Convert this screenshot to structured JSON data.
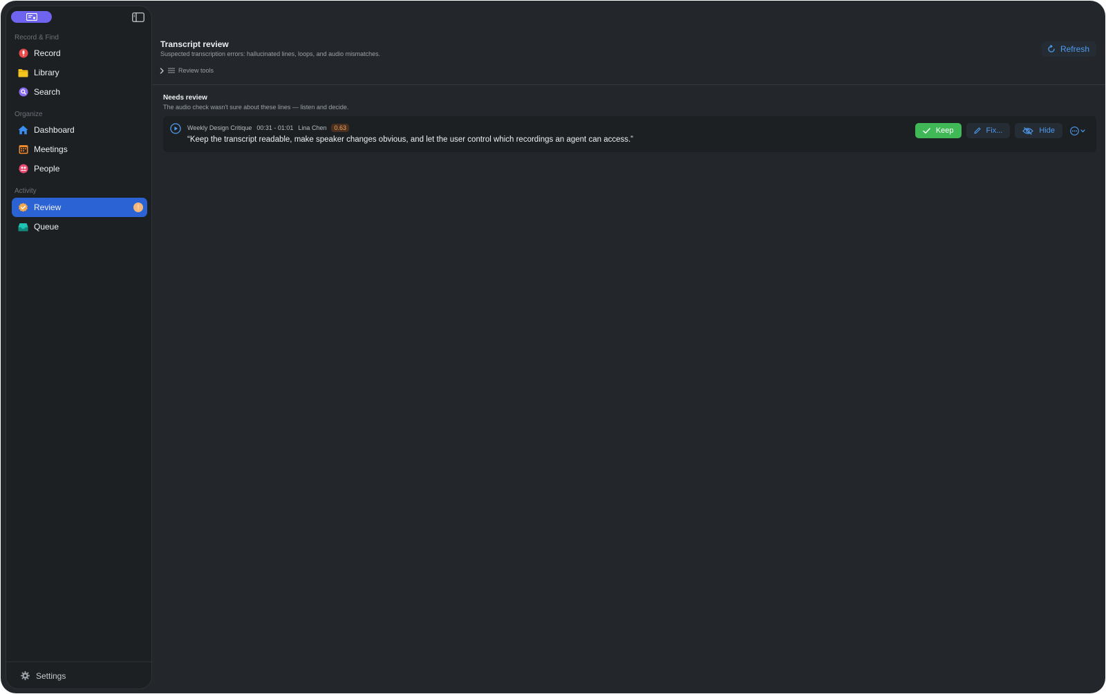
{
  "sidebar": {
    "sections": [
      {
        "label": "Record & Find"
      },
      {
        "label": "Organize"
      },
      {
        "label": "Activity"
      }
    ],
    "items": [
      {
        "label": "Record",
        "icon": "record-icon"
      },
      {
        "label": "Library",
        "icon": "folder-icon"
      },
      {
        "label": "Search",
        "icon": "search-icon"
      },
      {
        "label": "Dashboard",
        "icon": "home-icon"
      },
      {
        "label": "Meetings",
        "icon": "calendar-icon"
      },
      {
        "label": "People",
        "icon": "people-icon"
      },
      {
        "label": "Review",
        "icon": "review-badge-icon",
        "active": true,
        "badge": "!"
      },
      {
        "label": "Queue",
        "icon": "inbox-icon"
      }
    ],
    "settings_label": "Settings"
  },
  "header": {
    "title": "Transcript review",
    "subtitle": "Suspected transcription errors: hallucinated lines, loops, and audio mismatches.",
    "refresh_label": "Refresh",
    "tools_label": "Review tools"
  },
  "needs_review": {
    "title": "Needs review",
    "description": "The audio check wasn't sure about these lines — listen and decide.",
    "items": [
      {
        "meeting": "Weekly Design Critique",
        "time_range": "00:31 - 01:01",
        "speaker": "Lina Chen",
        "score": "0.63",
        "quote": "“Keep the transcript readable, make speaker changes obvious, and let the user control which recordings an agent can access.”",
        "keep_label": "Keep",
        "fix_label": "Fix...",
        "hide_label": "Hide"
      }
    ]
  },
  "colors": {
    "background": "#23272b",
    "sidebar": "#1d2023",
    "accent": "#2b62d4",
    "link": "#4f9bf2",
    "keep": "#3fb855",
    "score": "#f0a25c"
  }
}
